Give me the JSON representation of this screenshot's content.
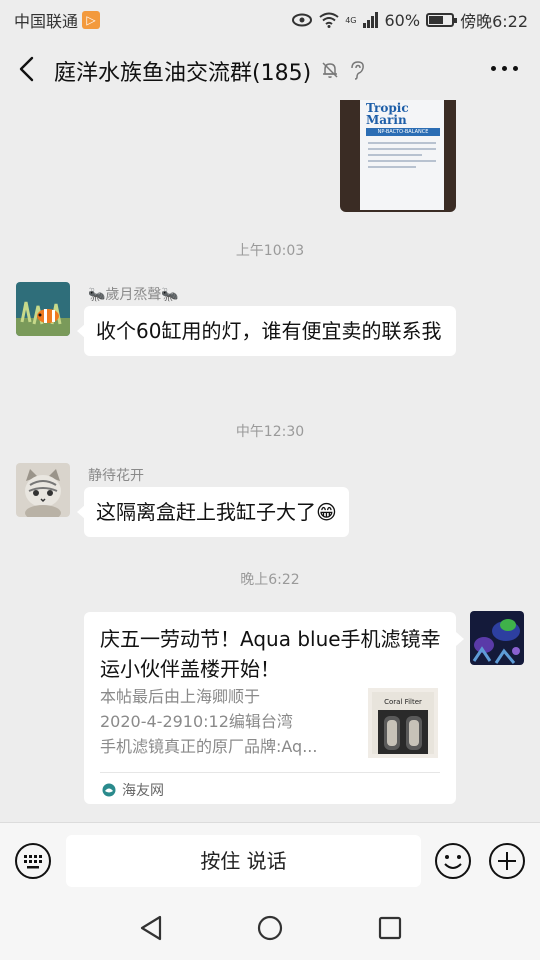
{
  "status_bar": {
    "carrier": "中国联通",
    "network": "4G",
    "battery_text": "60%",
    "battery_level": 0.6,
    "time": "傍晚6:22"
  },
  "header": {
    "title": "庭洋水族鱼油交流群(185)"
  },
  "chat": {
    "image_message": {
      "brand": "Tropic Marin",
      "product": "NP-BACTO-BALANCE"
    },
    "timestamps": [
      "上午10:03",
      "中午12:30",
      "晚上6:22"
    ],
    "messages": [
      {
        "sender": "🐜歲月烝聲🐜",
        "text": "收个60缸用的灯，谁有便宜卖的联系我"
      },
      {
        "sender": "静待花开",
        "text": "这隔离盒赶上我缸子大了😁"
      }
    ],
    "link_card": {
      "title": "庆五一劳动节！Aqua blue手机滤镜幸运小伙伴盖楼开始！",
      "desc_lines": [
        "本帖最后由上海卿顺于",
        "2020-4-2910:12编辑台湾",
        "手机滤镜真正的原厂品牌:Aq..."
      ],
      "thumb_label": "Coral Filter",
      "source": "海友网"
    }
  },
  "input_bar": {
    "hold_to_talk": "按住 说话"
  },
  "colors": {
    "background": "#ededed",
    "bubble": "#ffffff",
    "timestamp": "#9a9a9a",
    "carrier_badge": "#f39a3d"
  }
}
